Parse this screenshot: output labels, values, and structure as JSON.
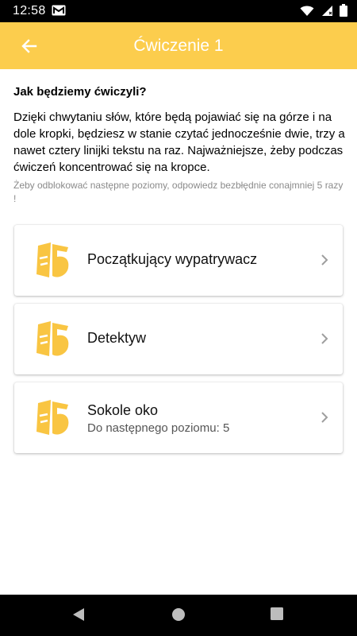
{
  "status_bar": {
    "time": "12:58"
  },
  "app_bar": {
    "title": "Ćwiczenie 1"
  },
  "content": {
    "heading": "Jak będziemy ćwiczyli?",
    "description": "Dzięki chwytaniu słów, które będą pojawiać się na górze i na dole kropki, będziesz w stanie czytać jednocześnie dwie, trzy a nawet cztery linijki tekstu na raz. Najważniejsze, żeby podczas ćwiczeń koncentrować się na kropce.",
    "hint": "Żeby odblokować następne poziomy, odpowiedz bezbłędnie conajmniej 5 razy !"
  },
  "levels": [
    {
      "title": "Początkujący wypatrywacz",
      "subtitle": ""
    },
    {
      "title": "Detektyw",
      "subtitle": ""
    },
    {
      "title": "Sokole oko",
      "subtitle": "Do następnego poziomu: 5"
    }
  ],
  "colors": {
    "accent": "#fccd4d",
    "icon": "#f9c542",
    "hint": "#8a8a8a"
  },
  "icons": {
    "back": "arrow-left-icon",
    "chevron": "chevron-right-icon",
    "level": "level-badge-icon"
  }
}
